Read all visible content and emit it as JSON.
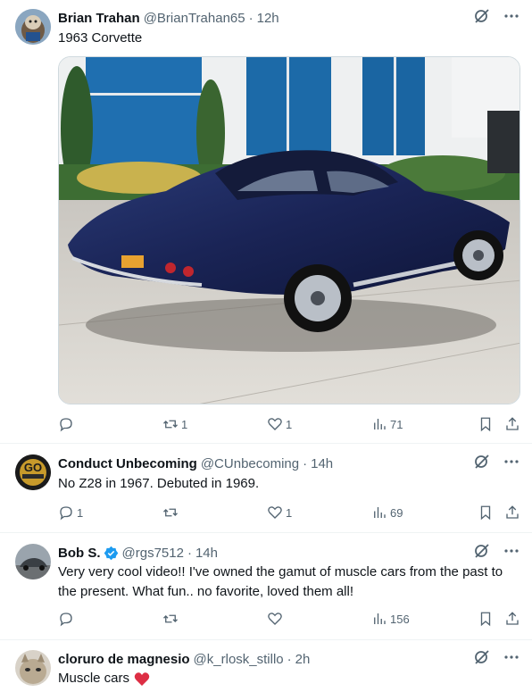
{
  "tweets": [
    {
      "name": "Brian Trahan",
      "handle": "@BrianTrahan65",
      "time": "12h",
      "text": "1963 Corvette",
      "replies": "",
      "retweets": "1",
      "likes": "1",
      "views": "71"
    },
    {
      "name": "Conduct Unbecoming",
      "handle": "@CUnbecoming",
      "time": "14h",
      "text": "No Z28 in 1967. Debuted  in 1969.",
      "replies": "1",
      "retweets": "",
      "likes": "1",
      "views": "69",
      "avatar_text": "GO"
    },
    {
      "name": "Bob S.",
      "handle": "@rgs7512",
      "time": "14h",
      "text": "Very very cool video!!  I've owned the gamut of muscle cars from the past to the present. What fun.. no favorite, loved them all!",
      "replies": "",
      "retweets": "",
      "likes": "",
      "views": "156"
    },
    {
      "name": "cloruro de magnesio",
      "handle": "@k_rlosk_stillo",
      "time": "2h",
      "text": "Muscle cars"
    }
  ],
  "colors": {
    "text": "#0f1419",
    "secondary": "#536471",
    "verified": "#1d9bf0",
    "heart": "#f91880",
    "border": "#eff3f4"
  }
}
